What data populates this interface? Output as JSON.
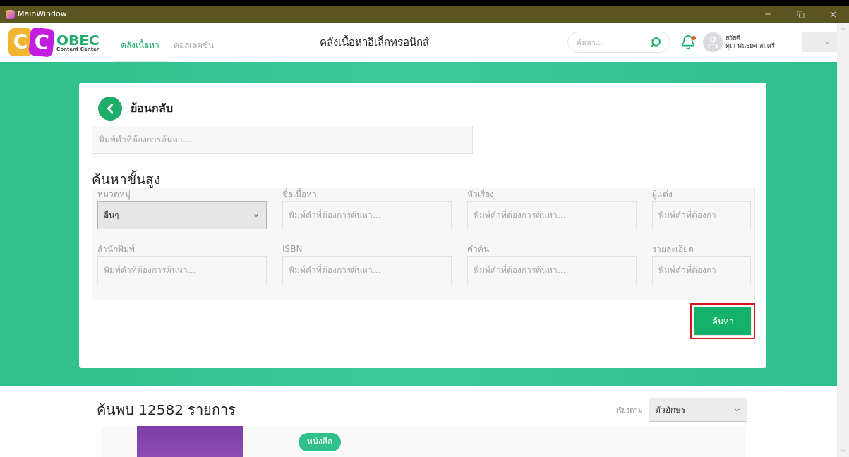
{
  "window": {
    "title": "MainWindow"
  },
  "header": {
    "logo": {
      "letters": [
        "C",
        "C"
      ],
      "name": "OBEC",
      "subtitle": "Content Center"
    },
    "tabs": [
      {
        "label": "คลังเนื้อหา",
        "selected": true
      },
      {
        "label": "คอลเลคชั่น",
        "selected": false
      }
    ],
    "title": "คลังเนื้อหาอิเล็กทรอนิกส์",
    "search": {
      "placeholder": "ค้นหา..."
    },
    "notification": {
      "unread": true
    },
    "user": {
      "greeting": "สวัสดี",
      "name": "คุณ พันธยศ สมศรี"
    }
  },
  "search_card": {
    "back_label": "ย้อนกลับ",
    "search": {
      "placeholder": "พิมพ์คำที่ต้องการค้นหา..."
    },
    "advanced_title": "ค้นหาขั้นสูง",
    "fields": [
      {
        "kind": "select",
        "label": "หมวดหมู่",
        "value": "อื่นๆ"
      },
      {
        "kind": "text",
        "label": "ชื่อเนื้อหา",
        "placeholder": "พิมพ์คำที่ต้องการค้นหา..."
      },
      {
        "kind": "text",
        "label": "หัวเรื่อง",
        "placeholder": "พิมพ์คำที่ต้องการค้นหา..."
      },
      {
        "kind": "text",
        "label": "ผู้แต่ง",
        "placeholder": "พิมพ์คำที่ต้องกา"
      },
      {
        "kind": "text",
        "label": "สำนักพิมพ์",
        "placeholder": "พิมพ์คำที่ต้องการค้นหา..."
      },
      {
        "kind": "text",
        "label": "ISBN",
        "placeholder": "พิมพ์คำที่ต้องการค้นหา..."
      },
      {
        "kind": "text",
        "label": "คำค้น",
        "placeholder": "พิมพ์คำที่ต้องการค้นหา..."
      },
      {
        "kind": "text",
        "label": "รายละเอียด",
        "placeholder": "พิมพ์คำที่ต้องกา"
      }
    ],
    "submit": {
      "label": "ค้นหา",
      "highlighted": true
    }
  },
  "results": {
    "count_text": "ค้นพบ 12582 รายการ",
    "sort": {
      "label": "เรียงตาม",
      "value": "ตัวอักษร"
    },
    "items": [
      {
        "badge": "หนังสือ"
      }
    ]
  }
}
